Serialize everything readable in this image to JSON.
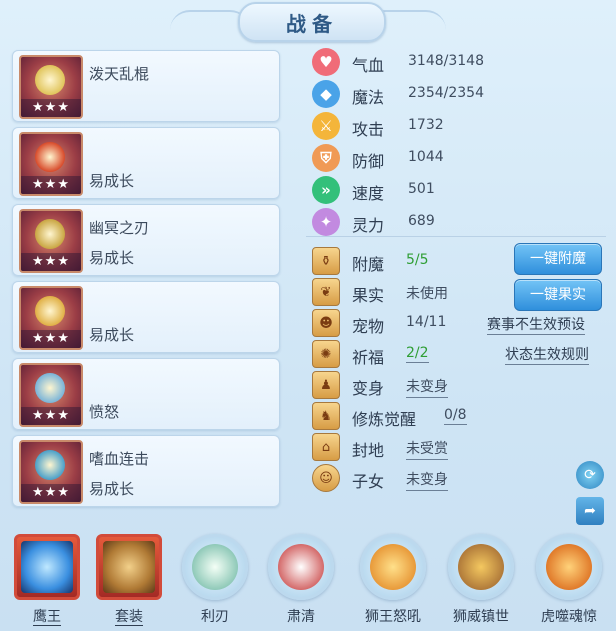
{
  "header": {
    "title": "战备"
  },
  "equipment": [
    {
      "name": "泼天乱棍",
      "sub": "",
      "stars": "★★★",
      "color": "#e0c45a"
    },
    {
      "name": "",
      "sub": "易成长",
      "stars": "★★★",
      "color": "#d84a2a"
    },
    {
      "name": "幽冥之刃",
      "sub": "易成长",
      "stars": "★★★",
      "color": "#c9a642"
    },
    {
      "name": "",
      "sub": "易成长",
      "stars": "★★★",
      "color": "#e0b045"
    },
    {
      "name": "",
      "sub": "愤怒",
      "stars": "★★★",
      "color": "#7ab4d8"
    },
    {
      "name": "嗜血连击",
      "sub": "易成长",
      "stars": "★★★",
      "color": "#4aa0c9"
    }
  ],
  "stats": [
    {
      "label": "气血",
      "value": "3148/3148",
      "icon": "heart-icon",
      "color": "#f06c78",
      "glyph": "♥"
    },
    {
      "label": "魔法",
      "value": "2354/2354",
      "icon": "mana-icon",
      "color": "#4aa3e8",
      "glyph": "◆"
    },
    {
      "label": "攻击",
      "value": "1732",
      "icon": "sword-icon",
      "color": "#f4b53a",
      "glyph": "⚔"
    },
    {
      "label": "防御",
      "value": "1044",
      "icon": "shield-icon",
      "color": "#f09a55",
      "glyph": "⛨"
    },
    {
      "label": "速度",
      "value": "501",
      "icon": "speed-icon",
      "color": "#33c07a",
      "glyph": "»"
    },
    {
      "label": "灵力",
      "value": "689",
      "icon": "spirit-icon",
      "color": "#c28ae0",
      "glyph": "✦"
    }
  ],
  "attrs": [
    {
      "label": "附魔",
      "value": "5/5",
      "green": true,
      "underline": false,
      "icon": "enchant-icon",
      "glyph": "⚱"
    },
    {
      "label": "果实",
      "value": "未使用",
      "green": false,
      "underline": false,
      "icon": "fruit-icon",
      "glyph": "❦"
    },
    {
      "label": "宠物",
      "value": "14/11",
      "green": false,
      "underline": false,
      "icon": "pet-icon",
      "glyph": "☻"
    },
    {
      "label": "祈福",
      "value": "2/2",
      "green": true,
      "underline": true,
      "icon": "blessing-icon",
      "glyph": "✺"
    },
    {
      "label": "变身",
      "value": "未变身",
      "green": false,
      "underline": true,
      "icon": "transform-icon",
      "glyph": "♟"
    },
    {
      "label": "修炼觉醒",
      "value": "0/8",
      "green": false,
      "underline": true,
      "icon": "cultivation-icon",
      "glyph": "♞"
    },
    {
      "label": "封地",
      "value": "未受赏",
      "green": false,
      "underline": true,
      "icon": "fief-icon",
      "glyph": "⌂"
    },
    {
      "label": "子女",
      "value": "未变身",
      "green": false,
      "underline": true,
      "icon": "child-icon",
      "glyph": "☺"
    }
  ],
  "buttons": {
    "enchant": "一键附魔",
    "fruit": "一键果实"
  },
  "links": {
    "event_preset": "赛事不生效预设",
    "status_rules": "状态生效规则"
  },
  "bottom_slots": [
    {
      "label": "鹰王",
      "shape": "square",
      "underline": true,
      "color": "#3a8fe0"
    },
    {
      "label": "套装",
      "shape": "square",
      "underline": true,
      "color": "#b07a35"
    },
    {
      "label": "利刃",
      "shape": "round",
      "underline": false,
      "color": "#8fc9b8"
    },
    {
      "label": "肃清",
      "shape": "round",
      "underline": false,
      "color": "#d46a6a"
    },
    {
      "label": "狮王怒吼",
      "shape": "round",
      "underline": false,
      "color": "#e89a3a"
    },
    {
      "label": "狮威镇世",
      "shape": "round",
      "underline": false,
      "color": "#b07a3a"
    },
    {
      "label": "虎噬魂惊",
      "shape": "round",
      "underline": false,
      "color": "#e07a2a"
    }
  ]
}
